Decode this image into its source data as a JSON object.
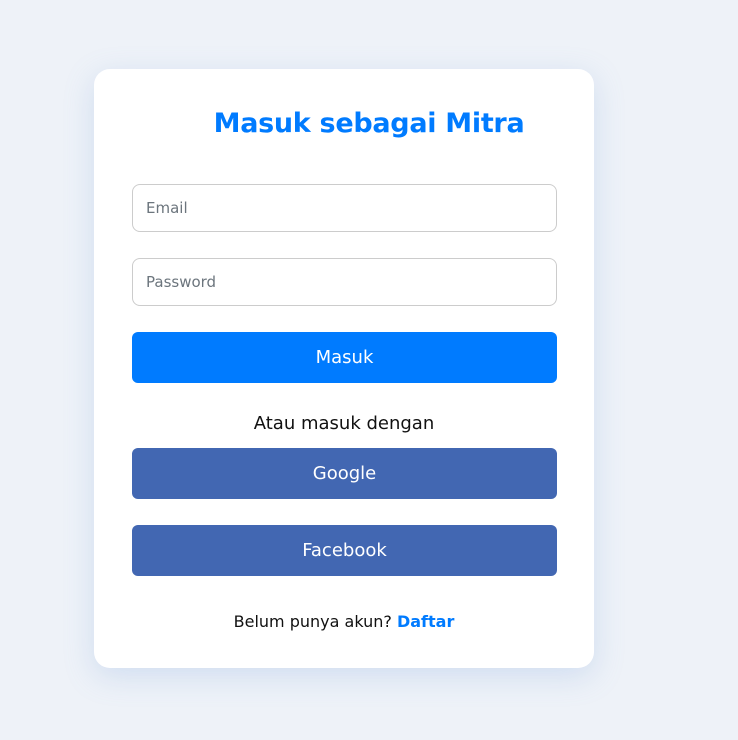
{
  "title": "Masuk sebagai Mitra",
  "email": {
    "placeholder": "Email",
    "value": ""
  },
  "password": {
    "placeholder": "Password",
    "value": ""
  },
  "login_button": "Masuk",
  "alt_text": "Atau masuk dengan",
  "google_button": "Google",
  "facebook_button": "Facebook",
  "footer": {
    "prompt": "Belum punya akun?",
    "link": "Daftar"
  },
  "colors": {
    "primary": "#007bff",
    "social": "#4267b2",
    "background": "#eef2f8"
  }
}
